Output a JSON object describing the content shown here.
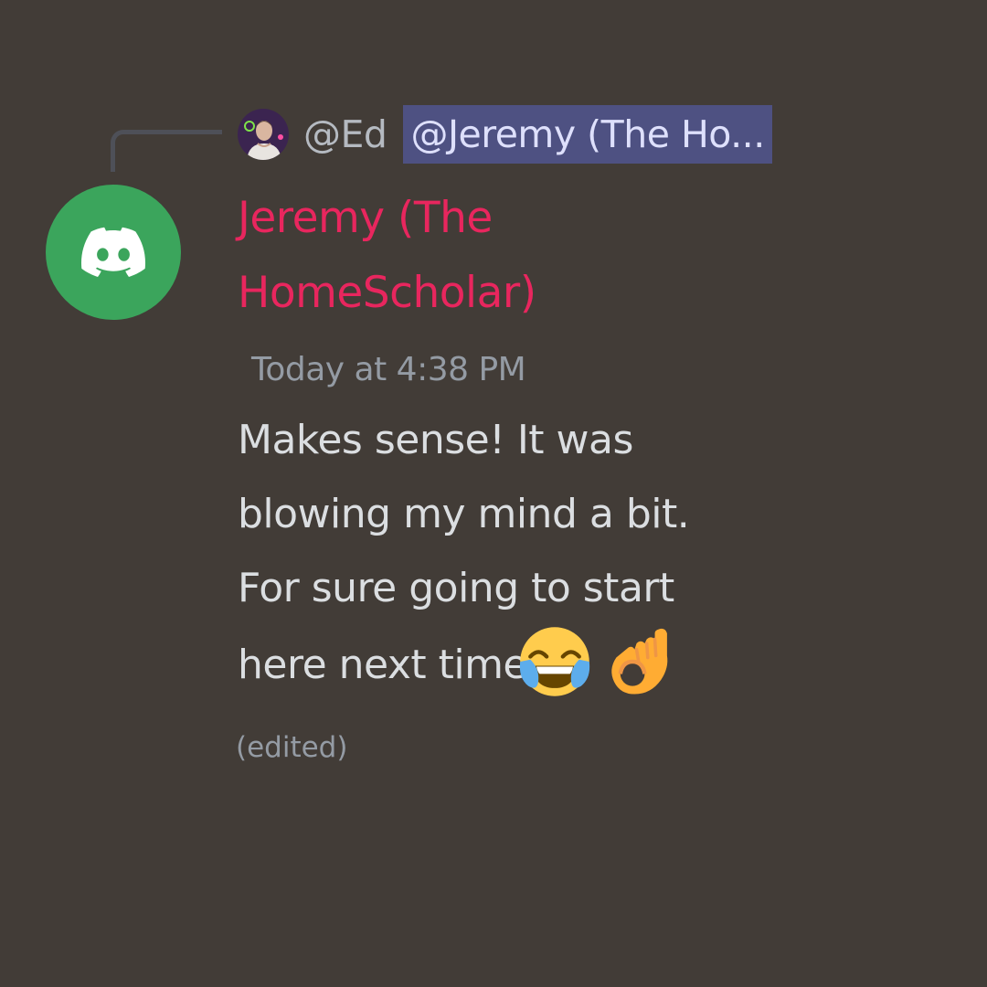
{
  "reply": {
    "author": "@Ed",
    "mention": "@Jeremy (The Ho..."
  },
  "message": {
    "author_name": "Jeremy (The HomeScholar)",
    "timestamp": "Today at 4:38 PM",
    "lines": [
      "Makes sense! It was",
      "blowing my mind a bit.",
      "For sure going to start",
      "here next time"
    ],
    "edited_label": "(edited)",
    "emojis": [
      "face-with-tears-of-joy-emoji",
      "ok-hand-emoji"
    ]
  },
  "colors": {
    "background": "#423c37",
    "author_name": "#e8265e",
    "mention_bg": "#4e5182",
    "mention_text": "#dee0fc",
    "avatar_green": "#3ba55c",
    "message_text": "#dbdee1",
    "muted_text": "#949ba4"
  },
  "icons": {
    "main_avatar": "discord-logo-icon",
    "reply_avatar": "user-avatar-icon"
  }
}
